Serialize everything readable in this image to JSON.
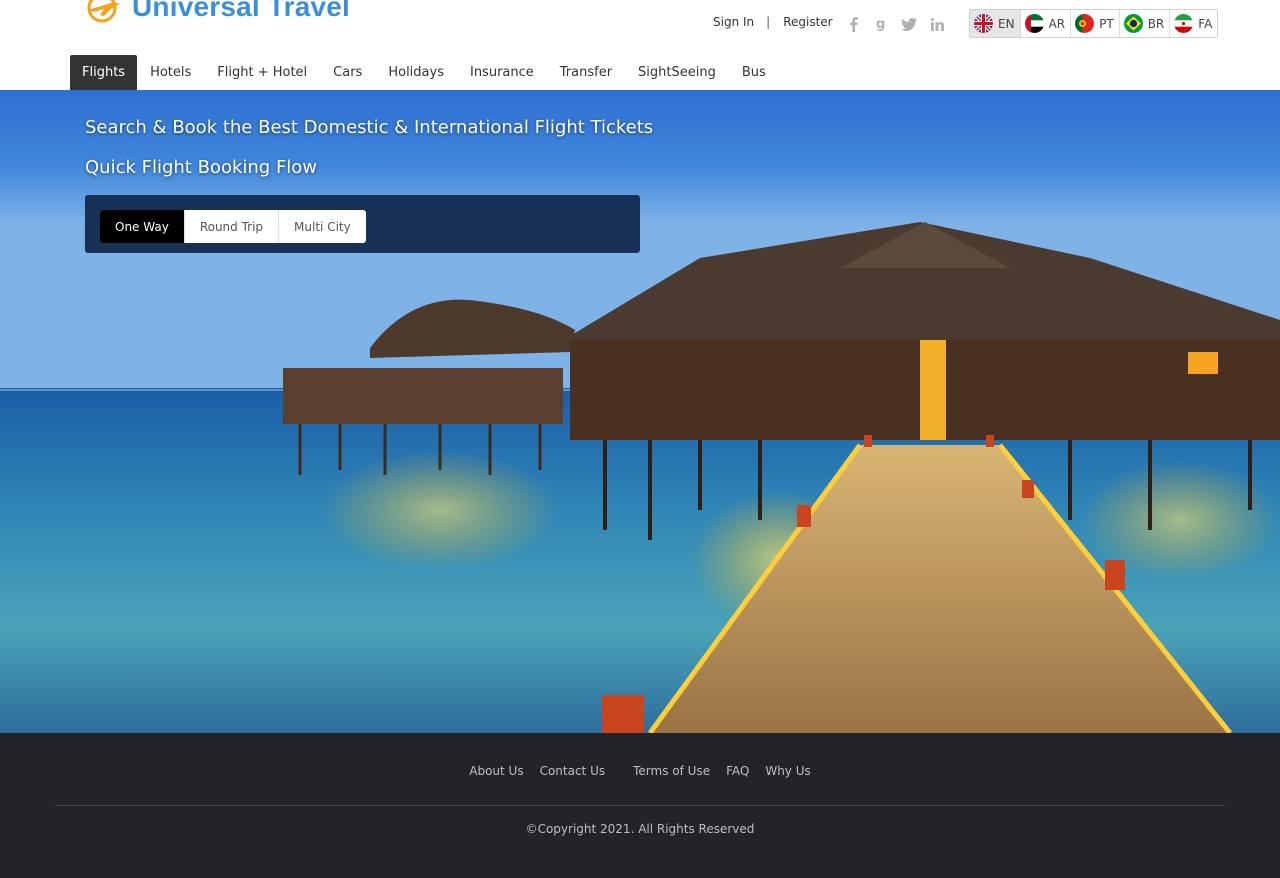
{
  "brand": {
    "name": "Universal Travel",
    "color": "#3b8fd9"
  },
  "auth": {
    "sign_in": "Sign In",
    "separator": "|",
    "register": "Register"
  },
  "social": [
    "facebook-icon",
    "google-icon",
    "twitter-icon",
    "linkedin-icon"
  ],
  "languages": [
    {
      "code": "EN",
      "flag": "uk-flag-icon",
      "active": true
    },
    {
      "code": "AR",
      "flag": "uae-flag-icon",
      "active": false
    },
    {
      "code": "PT",
      "flag": "portugal-flag-icon",
      "active": false
    },
    {
      "code": "BR",
      "flag": "brazil-flag-icon",
      "active": false
    },
    {
      "code": "FA",
      "flag": "iran-flag-icon",
      "active": false
    }
  ],
  "nav": {
    "active": "Flights",
    "items": [
      "Flights",
      "Hotels",
      "Flight + Hotel",
      "Cars",
      "Holidays",
      "Insurance",
      "Transfer",
      "SightSeeing",
      "Bus"
    ]
  },
  "hero": {
    "title": "Search & Book the Best Domestic & International Flight Tickets",
    "subtitle": "Quick Flight Booking Flow",
    "trip_types": [
      "One Way",
      "Round Trip",
      "Multi City"
    ],
    "active_trip": "One Way"
  },
  "footer": {
    "links": [
      "About Us",
      "Contact Us",
      "Terms of Use",
      "FAQ",
      "Why Us"
    ],
    "copyright": "©Copyright 2021. All Rights Reserved"
  },
  "colors": {
    "nav_active_bg": "#333333",
    "footer_bg": "#232429",
    "search_box_bg": "#0a2042"
  }
}
